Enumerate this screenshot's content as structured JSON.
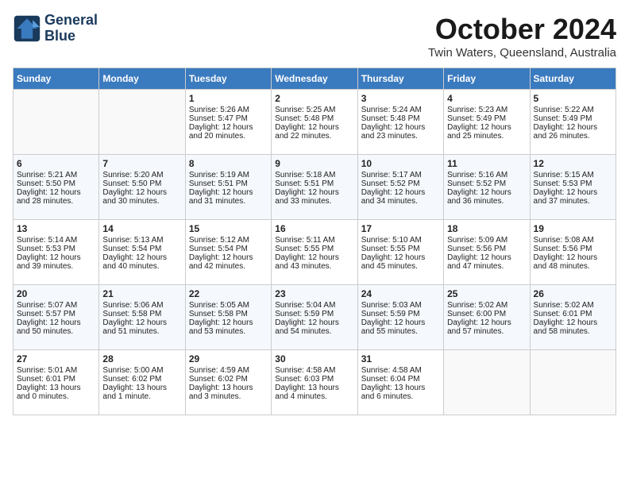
{
  "header": {
    "logo_line1": "General",
    "logo_line2": "Blue",
    "month": "October 2024",
    "location": "Twin Waters, Queensland, Australia"
  },
  "days_of_week": [
    "Sunday",
    "Monday",
    "Tuesday",
    "Wednesday",
    "Thursday",
    "Friday",
    "Saturday"
  ],
  "weeks": [
    [
      {
        "day": "",
        "content": ""
      },
      {
        "day": "",
        "content": ""
      },
      {
        "day": "1",
        "content": "Sunrise: 5:26 AM\nSunset: 5:47 PM\nDaylight: 12 hours and 20 minutes."
      },
      {
        "day": "2",
        "content": "Sunrise: 5:25 AM\nSunset: 5:48 PM\nDaylight: 12 hours and 22 minutes."
      },
      {
        "day": "3",
        "content": "Sunrise: 5:24 AM\nSunset: 5:48 PM\nDaylight: 12 hours and 23 minutes."
      },
      {
        "day": "4",
        "content": "Sunrise: 5:23 AM\nSunset: 5:49 PM\nDaylight: 12 hours and 25 minutes."
      },
      {
        "day": "5",
        "content": "Sunrise: 5:22 AM\nSunset: 5:49 PM\nDaylight: 12 hours and 26 minutes."
      }
    ],
    [
      {
        "day": "6",
        "content": "Sunrise: 5:21 AM\nSunset: 5:50 PM\nDaylight: 12 hours and 28 minutes."
      },
      {
        "day": "7",
        "content": "Sunrise: 5:20 AM\nSunset: 5:50 PM\nDaylight: 12 hours and 30 minutes."
      },
      {
        "day": "8",
        "content": "Sunrise: 5:19 AM\nSunset: 5:51 PM\nDaylight: 12 hours and 31 minutes."
      },
      {
        "day": "9",
        "content": "Sunrise: 5:18 AM\nSunset: 5:51 PM\nDaylight: 12 hours and 33 minutes."
      },
      {
        "day": "10",
        "content": "Sunrise: 5:17 AM\nSunset: 5:52 PM\nDaylight: 12 hours and 34 minutes."
      },
      {
        "day": "11",
        "content": "Sunrise: 5:16 AM\nSunset: 5:52 PM\nDaylight: 12 hours and 36 minutes."
      },
      {
        "day": "12",
        "content": "Sunrise: 5:15 AM\nSunset: 5:53 PM\nDaylight: 12 hours and 37 minutes."
      }
    ],
    [
      {
        "day": "13",
        "content": "Sunrise: 5:14 AM\nSunset: 5:53 PM\nDaylight: 12 hours and 39 minutes."
      },
      {
        "day": "14",
        "content": "Sunrise: 5:13 AM\nSunset: 5:54 PM\nDaylight: 12 hours and 40 minutes."
      },
      {
        "day": "15",
        "content": "Sunrise: 5:12 AM\nSunset: 5:54 PM\nDaylight: 12 hours and 42 minutes."
      },
      {
        "day": "16",
        "content": "Sunrise: 5:11 AM\nSunset: 5:55 PM\nDaylight: 12 hours and 43 minutes."
      },
      {
        "day": "17",
        "content": "Sunrise: 5:10 AM\nSunset: 5:55 PM\nDaylight: 12 hours and 45 minutes."
      },
      {
        "day": "18",
        "content": "Sunrise: 5:09 AM\nSunset: 5:56 PM\nDaylight: 12 hours and 47 minutes."
      },
      {
        "day": "19",
        "content": "Sunrise: 5:08 AM\nSunset: 5:56 PM\nDaylight: 12 hours and 48 minutes."
      }
    ],
    [
      {
        "day": "20",
        "content": "Sunrise: 5:07 AM\nSunset: 5:57 PM\nDaylight: 12 hours and 50 minutes."
      },
      {
        "day": "21",
        "content": "Sunrise: 5:06 AM\nSunset: 5:58 PM\nDaylight: 12 hours and 51 minutes."
      },
      {
        "day": "22",
        "content": "Sunrise: 5:05 AM\nSunset: 5:58 PM\nDaylight: 12 hours and 53 minutes."
      },
      {
        "day": "23",
        "content": "Sunrise: 5:04 AM\nSunset: 5:59 PM\nDaylight: 12 hours and 54 minutes."
      },
      {
        "day": "24",
        "content": "Sunrise: 5:03 AM\nSunset: 5:59 PM\nDaylight: 12 hours and 55 minutes."
      },
      {
        "day": "25",
        "content": "Sunrise: 5:02 AM\nSunset: 6:00 PM\nDaylight: 12 hours and 57 minutes."
      },
      {
        "day": "26",
        "content": "Sunrise: 5:02 AM\nSunset: 6:01 PM\nDaylight: 12 hours and 58 minutes."
      }
    ],
    [
      {
        "day": "27",
        "content": "Sunrise: 5:01 AM\nSunset: 6:01 PM\nDaylight: 13 hours and 0 minutes."
      },
      {
        "day": "28",
        "content": "Sunrise: 5:00 AM\nSunset: 6:02 PM\nDaylight: 13 hours and 1 minute."
      },
      {
        "day": "29",
        "content": "Sunrise: 4:59 AM\nSunset: 6:02 PM\nDaylight: 13 hours and 3 minutes."
      },
      {
        "day": "30",
        "content": "Sunrise: 4:58 AM\nSunset: 6:03 PM\nDaylight: 13 hours and 4 minutes."
      },
      {
        "day": "31",
        "content": "Sunrise: 4:58 AM\nSunset: 6:04 PM\nDaylight: 13 hours and 6 minutes."
      },
      {
        "day": "",
        "content": ""
      },
      {
        "day": "",
        "content": ""
      }
    ]
  ]
}
